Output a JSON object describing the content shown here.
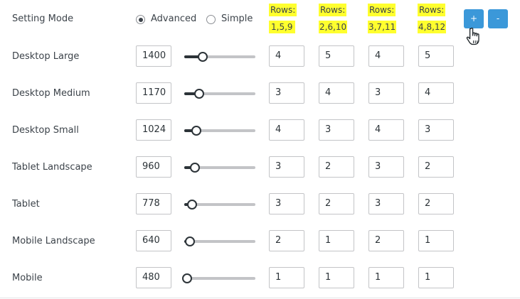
{
  "setting_mode": {
    "label": "Setting Mode",
    "options": [
      {
        "label": "Advanced",
        "checked": true
      },
      {
        "label": "Simple",
        "checked": false
      }
    ]
  },
  "columns": [
    {
      "header": "Rows:",
      "rows": "1,5,9"
    },
    {
      "header": "Rows:",
      "rows": "2,6,10"
    },
    {
      "header": "Rows:",
      "rows": "3,7,11"
    },
    {
      "header": "Rows:",
      "rows": "4,8,12"
    }
  ],
  "buttons": {
    "add": "+",
    "remove": "-"
  },
  "slider_range": {
    "min": 480,
    "max": 1400
  },
  "devices": [
    {
      "label": "Desktop Large",
      "width": "1400",
      "values": [
        "4",
        "5",
        "4",
        "5"
      ]
    },
    {
      "label": "Desktop Medium",
      "width": "1170",
      "values": [
        "3",
        "4",
        "3",
        "4"
      ]
    },
    {
      "label": "Desktop Small",
      "width": "1024",
      "values": [
        "4",
        "3",
        "4",
        "3"
      ]
    },
    {
      "label": "Tablet Landscape",
      "width": "960",
      "values": [
        "3",
        "2",
        "3",
        "2"
      ]
    },
    {
      "label": "Tablet",
      "width": "778",
      "values": [
        "3",
        "2",
        "3",
        "2"
      ]
    },
    {
      "label": "Mobile Landscape",
      "width": "640",
      "values": [
        "2",
        "1",
        "2",
        "1"
      ]
    },
    {
      "label": "Mobile",
      "width": "480",
      "values": [
        "1",
        "1",
        "1",
        "1"
      ]
    }
  ],
  "colors": {
    "accent": "#3b98d9",
    "highlight": "#ffff2e"
  },
  "icons": {
    "cursor": "hand-pointer-icon"
  }
}
